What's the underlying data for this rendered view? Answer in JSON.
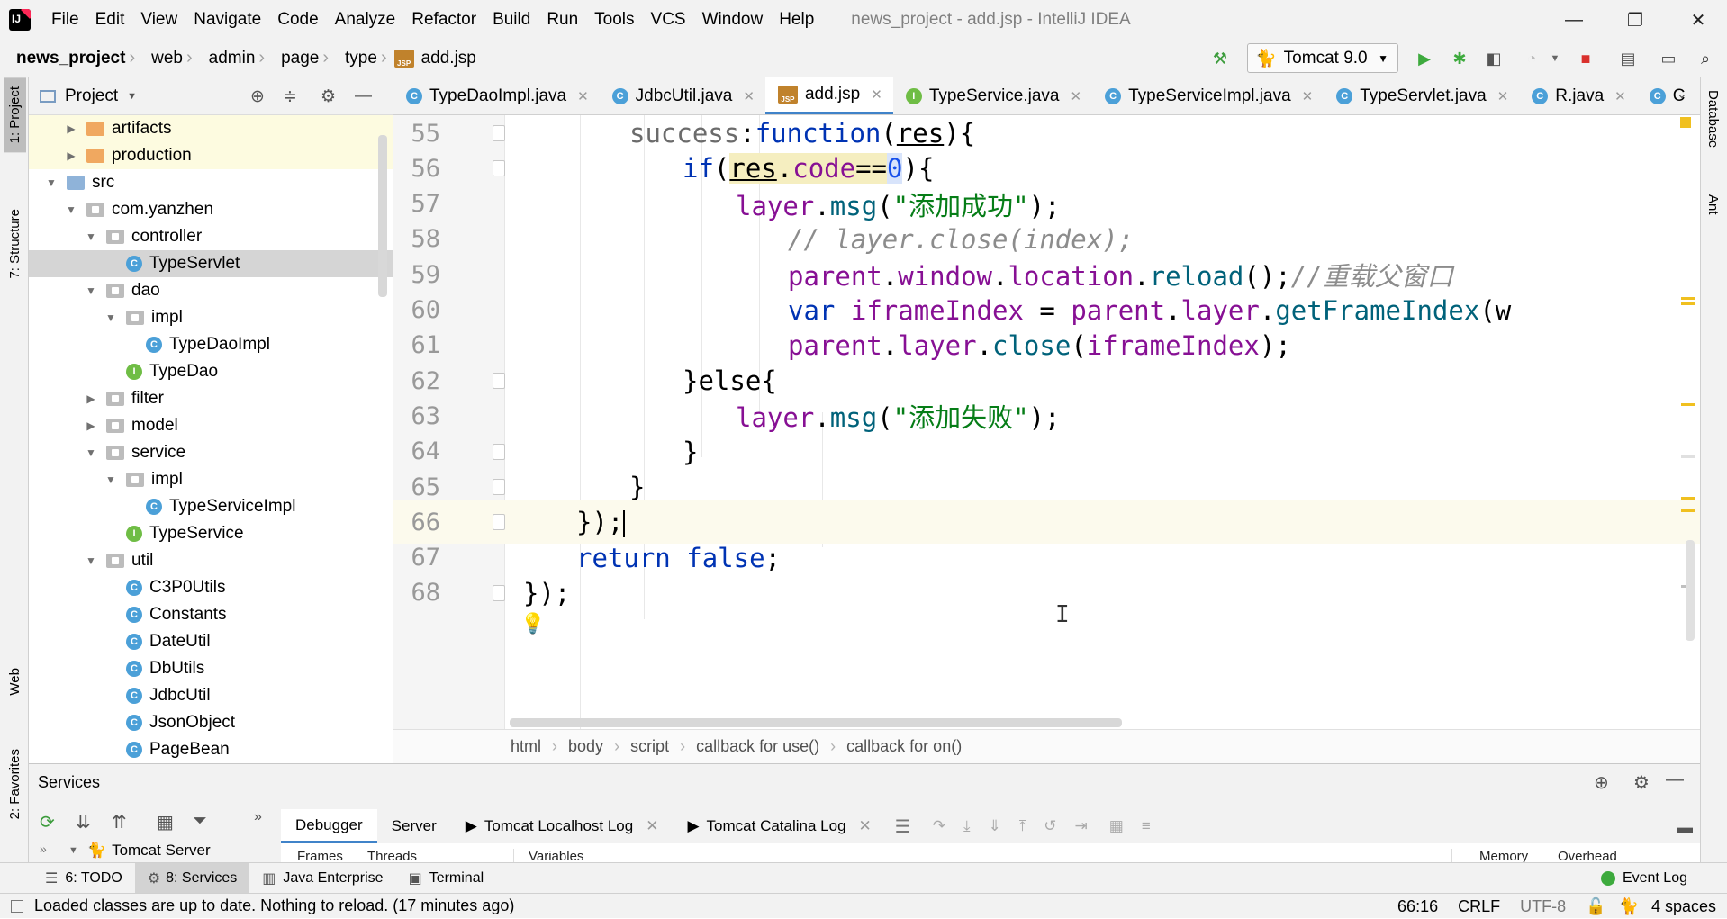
{
  "window": {
    "title": "news_project - add.jsp - IntelliJ IDEA",
    "menu": [
      "File",
      "Edit",
      "View",
      "Navigate",
      "Code",
      "Analyze",
      "Refactor",
      "Build",
      "Run",
      "Tools",
      "VCS",
      "Window",
      "Help"
    ],
    "minimize": "—",
    "restore": "❐",
    "close": "✕"
  },
  "nav": {
    "breadcrumbs": [
      "news_project",
      "web",
      "admin",
      "page",
      "type",
      "add.jsp"
    ],
    "run_config": "Tomcat 9.0"
  },
  "left_strip": {
    "project": "1: Project",
    "structure": "7: Structure",
    "web": "Web",
    "favorites": "2: Favorites"
  },
  "right_strip": {
    "database": "Database",
    "ant": "Ant"
  },
  "project_panel": {
    "title": "Project",
    "tree": [
      {
        "label": "artifacts",
        "type": "folder-orange",
        "arrow": "▶",
        "hl": true
      },
      {
        "label": "production",
        "type": "folder-orange",
        "arrow": "▶",
        "hl": true
      },
      {
        "label": "src",
        "type": "folder-blue",
        "arrow": "▼"
      },
      {
        "label": "com.yanzhen",
        "type": "pkg",
        "arrow": "▼"
      },
      {
        "label": "controller",
        "type": "pkg",
        "arrow": "▼"
      },
      {
        "label": "TypeServlet",
        "type": "class",
        "arrow": "",
        "sel": true
      },
      {
        "label": "dao",
        "type": "pkg",
        "arrow": "▼"
      },
      {
        "label": "impl",
        "type": "pkg",
        "arrow": "▼"
      },
      {
        "label": "TypeDaoImpl",
        "type": "class",
        "arrow": ""
      },
      {
        "label": "TypeDao",
        "type": "interface",
        "arrow": ""
      },
      {
        "label": "filter",
        "type": "pkg",
        "arrow": "▶"
      },
      {
        "label": "model",
        "type": "pkg",
        "arrow": "▶"
      },
      {
        "label": "service",
        "type": "pkg",
        "arrow": "▼"
      },
      {
        "label": "impl",
        "type": "pkg",
        "arrow": "▼"
      },
      {
        "label": "TypeServiceImpl",
        "type": "class",
        "arrow": ""
      },
      {
        "label": "TypeService",
        "type": "interface",
        "arrow": ""
      },
      {
        "label": "util",
        "type": "pkg",
        "arrow": "▼"
      },
      {
        "label": "C3P0Utils",
        "type": "class",
        "arrow": ""
      },
      {
        "label": "Constants",
        "type": "class",
        "arrow": ""
      },
      {
        "label": "DateUtil",
        "type": "class",
        "arrow": ""
      },
      {
        "label": "DbUtils",
        "type": "class",
        "arrow": ""
      },
      {
        "label": "JdbcUtil",
        "type": "class",
        "arrow": ""
      },
      {
        "label": "JsonObject",
        "type": "class",
        "arrow": ""
      },
      {
        "label": "PageBean",
        "type": "class",
        "arrow": ""
      }
    ]
  },
  "tabs": [
    {
      "label": "TypeDaoImpl.java",
      "icon": "class"
    },
    {
      "label": "JdbcUtil.java",
      "icon": "class"
    },
    {
      "label": "add.jsp",
      "icon": "jsp",
      "active": true
    },
    {
      "label": "TypeService.java",
      "icon": "interface"
    },
    {
      "label": "TypeServiceImpl.java",
      "icon": "class"
    },
    {
      "label": "TypeServlet.java",
      "icon": "class"
    },
    {
      "label": "R.java",
      "icon": "class"
    },
    {
      "label": "C",
      "icon": "class"
    }
  ],
  "jsp_icon_text": "JSP",
  "editor": {
    "lines": [
      {
        "n": "55"
      },
      {
        "n": "56"
      },
      {
        "n": "57"
      },
      {
        "n": "58"
      },
      {
        "n": "59"
      },
      {
        "n": "60"
      },
      {
        "n": "61"
      },
      {
        "n": "62"
      },
      {
        "n": "63"
      },
      {
        "n": "64"
      },
      {
        "n": "65"
      },
      {
        "n": "66"
      },
      {
        "n": "67"
      },
      {
        "n": "68"
      }
    ],
    "code": {
      "l55": {
        "a": "success",
        "b": ":",
        "c": "function",
        "d": "(",
        "e": "res",
        "f": "){"
      },
      "l56": {
        "a": "if",
        "b": "(",
        "c": "res",
        "d": ".",
        "e": "code",
        "f": "==",
        "g": "0",
        "h": "){"
      },
      "l57": {
        "a": "layer",
        "b": ".",
        "c": "msg",
        "d": "(",
        "e": "\"添加成功\"",
        "f": ");"
      },
      "l58": {
        "a": "// layer.close(index);"
      },
      "l59": {
        "a": "parent",
        "b": ".",
        "c": "window",
        "d": ".",
        "e": "location",
        "f": ".",
        "g": "reload",
        "h": "();",
        "i": "//重载父窗口"
      },
      "l60": {
        "a": "var",
        "b": " ",
        "c": "iframeIndex",
        "d": " = ",
        "e": "parent",
        "f": ".",
        "g": "layer",
        "h": ".",
        "i": "getFrameIndex",
        "j": "(w"
      },
      "l61": {
        "a": "parent",
        "b": ".",
        "c": "layer",
        "d": ".",
        "e": "close",
        "f": "(",
        "g": "iframeIndex",
        "h": ");"
      },
      "l62": {
        "a": "}else{"
      },
      "l63": {
        "a": "layer",
        "b": ".",
        "c": "msg",
        "d": "(",
        "e": "\"添加失败\"",
        "f": ");"
      },
      "l64": {
        "a": "}"
      },
      "l65": {
        "a": "}"
      },
      "l66": {
        "a": "});"
      },
      "l67": {
        "a": "return",
        "b": " ",
        "c": "false",
        "d": ";"
      },
      "l68": {
        "a": "});"
      }
    }
  },
  "code_breadcrumb": [
    "html",
    "body",
    "script",
    "callback for use()",
    "callback for on()"
  ],
  "services": {
    "title": "Services",
    "tree_root": "Tomcat Server",
    "tabs": [
      "Debugger",
      "Server",
      "Tomcat Localhost Log",
      "Tomcat Catalina Log"
    ],
    "subheaders": [
      "Frames",
      "Threads",
      "Variables",
      "Memory",
      "Overhead"
    ]
  },
  "tool_windows": [
    {
      "label": "6: TODO"
    },
    {
      "label": "8: Services",
      "sel": true
    },
    {
      "label": "Java Enterprise"
    },
    {
      "label": "Terminal"
    }
  ],
  "event_log": "Event Log",
  "status": {
    "message": "Loaded classes are up to date. Nothing to reload. (17 minutes ago)",
    "position": "66:16",
    "line_sep": "CRLF",
    "encoding": "UTF-8",
    "indent": "4 spaces"
  },
  "colors": {
    "accent": "#4083c9",
    "keyword": "#0033b3",
    "string": "#067d17",
    "property": "#871094",
    "function": "#00627a",
    "number": "#1750eb"
  }
}
